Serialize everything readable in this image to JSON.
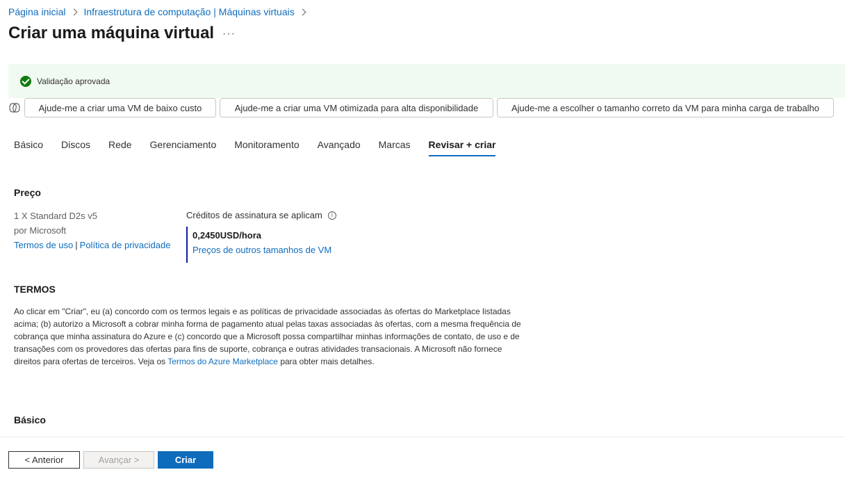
{
  "breadcrumb": {
    "items": [
      "Página inicial",
      "Infraestrutura de computação | Máquinas virtuais"
    ]
  },
  "page": {
    "title": "Criar uma máquina virtual",
    "more_label": "···"
  },
  "validation": {
    "text": "Validação aprovada",
    "color": "#107c10"
  },
  "copilot": {
    "icon": "copilot-icon",
    "prompts": [
      "Ajude-me a criar uma VM de baixo custo",
      "Ajude-me a criar uma VM otimizada para alta disponibilidade",
      "Ajude-me a escolher o tamanho correto da VM para minha carga de trabalho"
    ]
  },
  "tabs": [
    "Básico",
    "Discos",
    "Rede",
    "Gerenciamento",
    "Monitoramento",
    "Avançado",
    "Marcas",
    "Revisar + criar"
  ],
  "active_tab": "Revisar + criar",
  "price": {
    "heading": "Preço",
    "product": "1 X Standard D2s v5",
    "publisher": "por Microsoft",
    "terms_link": "Termos de uso",
    "separator": "|",
    "privacy_link": "Política de privacidade",
    "credits_label": "Créditos de assinatura se aplicam",
    "value": "0,2450USD/hora",
    "other_sizes_link": "Preços de outros tamanhos de VM"
  },
  "terms": {
    "heading": "TERMOS",
    "text_before": "Ao clicar em \"Criar\", eu (a) concordo com os termos legais e as políticas de privacidade associadas às ofertas do Marketplace listadas acima; (b) autorizo a Microsoft a cobrar minha forma de pagamento atual pelas taxas associadas às ofertas, com a mesma frequência de cobrança que minha assinatura do Azure e (c) concordo que a Microsoft possa compartilhar minhas informações de contato, de uso e de transações com os provedores das ofertas para fins de suporte, cobrança e outras atividades transacionais. A Microsoft não fornece direitos para ofertas de terceiros. Veja os ",
    "link": "Termos do Azure Marketplace",
    "text_after": " para obter mais detalhes."
  },
  "basic_section": {
    "heading": "Básico"
  },
  "footer": {
    "prev_label": "< Anterior",
    "next_label": "Avançar >",
    "create_label": "Criar"
  },
  "colors": {
    "accent": "#0f6cbd",
    "banner_bg": "#f1faf1",
    "price_bar": "#0f1d9e"
  }
}
